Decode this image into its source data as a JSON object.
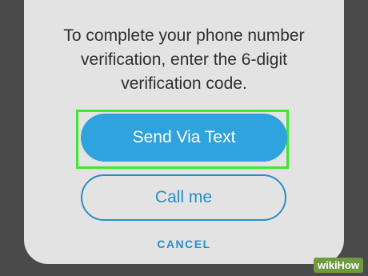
{
  "dialog": {
    "message_lines": [
      "To complete your phone number",
      "verification, enter the 6-digit",
      "verification code."
    ],
    "primary_button": "Send Via Text",
    "secondary_button": "Call me",
    "cancel_link": "CANCEL"
  },
  "watermark": "wikiHow",
  "colors": {
    "background": "#4a4a4a",
    "sheet": "#e3e3e3",
    "primary": "#2ea3de",
    "accent": "#2a8ec4",
    "highlight": "#3ee82a"
  }
}
